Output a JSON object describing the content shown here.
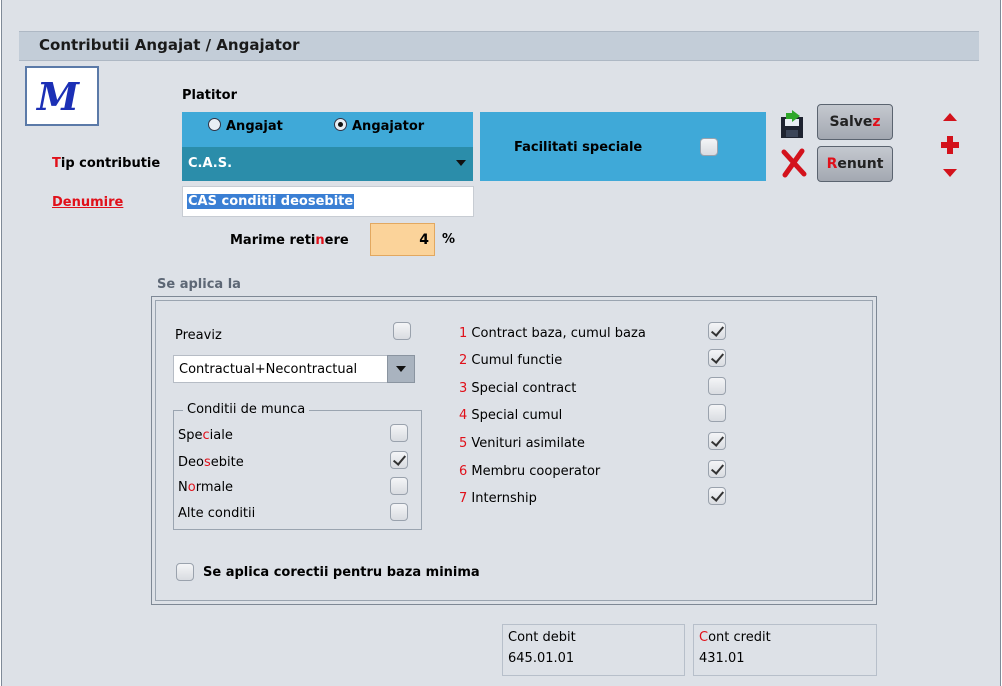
{
  "title": "Contributii Angajat / Angajator",
  "logo_text": "M",
  "platitor": {
    "label": "Platitor",
    "options": [
      {
        "label": "Angajat",
        "selected": false
      },
      {
        "label": "Angajator",
        "selected": true
      }
    ]
  },
  "tip_contributie": {
    "label_first": "T",
    "label_rest": "ip contributie",
    "value": "C.A.S."
  },
  "denumire": {
    "label": "Denumire",
    "value": "CAS conditii deosebite"
  },
  "facilitati": {
    "label": "Facilitati speciale",
    "checked": false
  },
  "marime": {
    "label_a": "Marime reti",
    "label_b": "n",
    "label_c": "ere",
    "value": "4",
    "unit": "%"
  },
  "buttons": {
    "save_a": "Salve",
    "save_b": "z",
    "cancel_a": "R",
    "cancel_b": "enunt"
  },
  "se_aplica": {
    "title": "Se aplica la",
    "preaviz": {
      "label": "Preaviz",
      "checked": false
    },
    "select_value": "Contractual+Necontractual",
    "conditii_title": "Conditii de munca",
    "conditii": [
      {
        "pre": "Spe",
        "hot": "c",
        "post": "iale",
        "checked": false
      },
      {
        "pre": "Deo",
        "hot": "s",
        "post": "ebite",
        "checked": true
      },
      {
        "pre": "N",
        "hot": "o",
        "post": "rmale",
        "checked": false
      },
      {
        "pre": "Alte conditii",
        "hot": "",
        "post": "",
        "checked": false
      }
    ],
    "tipuri": [
      {
        "num": "1",
        "label": "Contract baza, cumul baza",
        "checked": true
      },
      {
        "num": "2",
        "label": "Cumul functie",
        "checked": true
      },
      {
        "num": "3",
        "label": "Special contract",
        "checked": false
      },
      {
        "num": "4",
        "label": "Special cumul",
        "checked": false
      },
      {
        "num": "5",
        "label": "Venituri asimilate",
        "checked": true
      },
      {
        "num": "6",
        "label": "Membru cooperator",
        "checked": true
      },
      {
        "num": "7",
        "label": "Internship",
        "checked": true
      }
    ],
    "corectii": {
      "label": "Se aplica corectii pentru baza minima",
      "checked": false
    }
  },
  "cont_debit": {
    "label": "Cont debit",
    "value": "645.01.01"
  },
  "cont_credit": {
    "label_first": "C",
    "label_rest": "ont credit",
    "value": "431.01"
  },
  "colors": {
    "panel_blue": "#3fa9d8",
    "panel_teal": "#2b8daa",
    "input_orange": "#fbd39a",
    "hotkey_red": "#e0101a"
  }
}
